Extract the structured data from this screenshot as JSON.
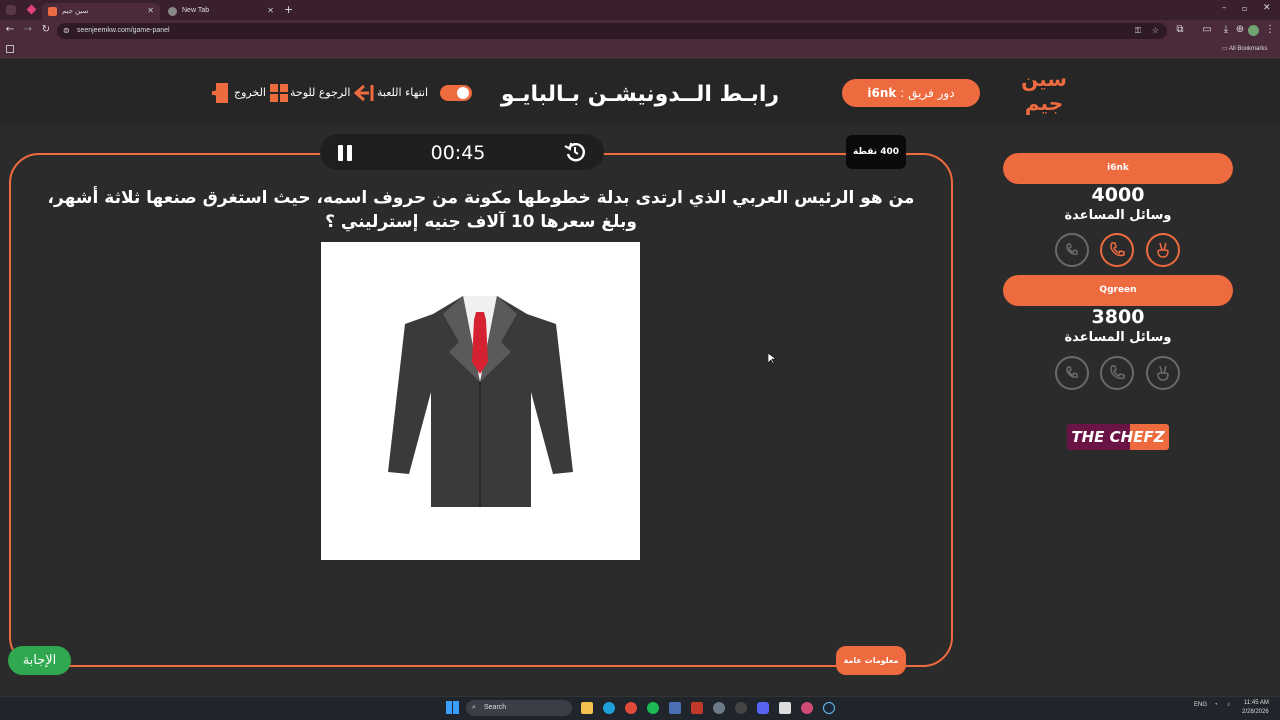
{
  "browser": {
    "tabs": [
      {
        "label": "سين جيم",
        "active": true
      },
      {
        "label": "New Tab",
        "active": false
      }
    ],
    "url": "seenjeemkw.com/game-panel",
    "bookmarks_label": "All Bookmarks"
  },
  "header": {
    "logo_text": "سين جيم",
    "team_turn_prefix": "دور فريق :",
    "team_turn_name": "i6nk",
    "game_title": "رابـط الــدونيشـن بـالبايـو",
    "controls": {
      "end_game": "انتهاء اللعبة",
      "back_to_board": "الرجوع للوحة",
      "exit": "الخروج"
    }
  },
  "board": {
    "timer": "00:45",
    "points": "400 نقطة",
    "question": "من هو الرئيس العربي الذي ارتدى بدلة خطوطها مكونة من حروف اسمه، حيث استغرق صنعها ثلاثة أشهر، وبلغ سعرها 10 آلاف جنيه إسترليني ؟",
    "answer_button": "الإجابة",
    "category": "معلومات عامة"
  },
  "teams": [
    {
      "name": "i6nk",
      "score": "4000",
      "helpers_label": "وسائل المساعدة",
      "helpers_active": [
        true,
        true,
        false
      ]
    },
    {
      "name": "Qgreen",
      "score": "3800",
      "helpers_label": "وسائل المساعدة",
      "helpers_active": [
        false,
        false,
        false
      ]
    }
  ],
  "sponsor": {
    "left": "THE",
    "right": "CHEFZ"
  },
  "taskbar": {
    "search_placeholder": "Search",
    "lang": "ENG",
    "time": "11:45 AM",
    "date": "2/28/2026"
  },
  "colors": {
    "accent": "#ee6a3f",
    "answer": "#2fa84f",
    "board_bg": "#2b2b2b"
  }
}
